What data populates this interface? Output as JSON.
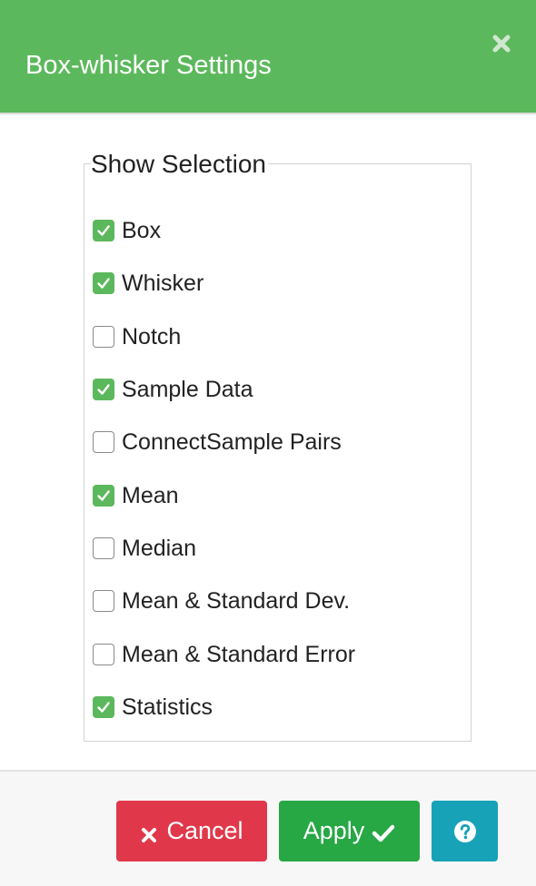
{
  "dialog": {
    "title": "Box-whisker Settings",
    "close_icon": "close-icon",
    "header_color": "#5cb85c"
  },
  "show_selection": {
    "legend": "Show Selection",
    "options": [
      {
        "label": "Box",
        "checked": true
      },
      {
        "label": "Whisker",
        "checked": true
      },
      {
        "label": "Notch",
        "checked": false
      },
      {
        "label": "Sample Data",
        "checked": true
      },
      {
        "label": "ConnectSample Pairs",
        "checked": false
      },
      {
        "label": "Mean",
        "checked": true
      },
      {
        "label": "Median",
        "checked": false
      },
      {
        "label": "Mean & Standard Dev.",
        "checked": false
      },
      {
        "label": "Mean & Standard Error",
        "checked": false
      },
      {
        "label": "Statistics",
        "checked": true
      }
    ]
  },
  "footer": {
    "cancel_label": "Cancel",
    "cancel_icon": "close-icon",
    "cancel_color": "#e0384a",
    "apply_label": "Apply",
    "apply_icon": "check-icon",
    "apply_color": "#28a745",
    "help_icon": "question-circle-icon",
    "help_color": "#17a2b8"
  }
}
